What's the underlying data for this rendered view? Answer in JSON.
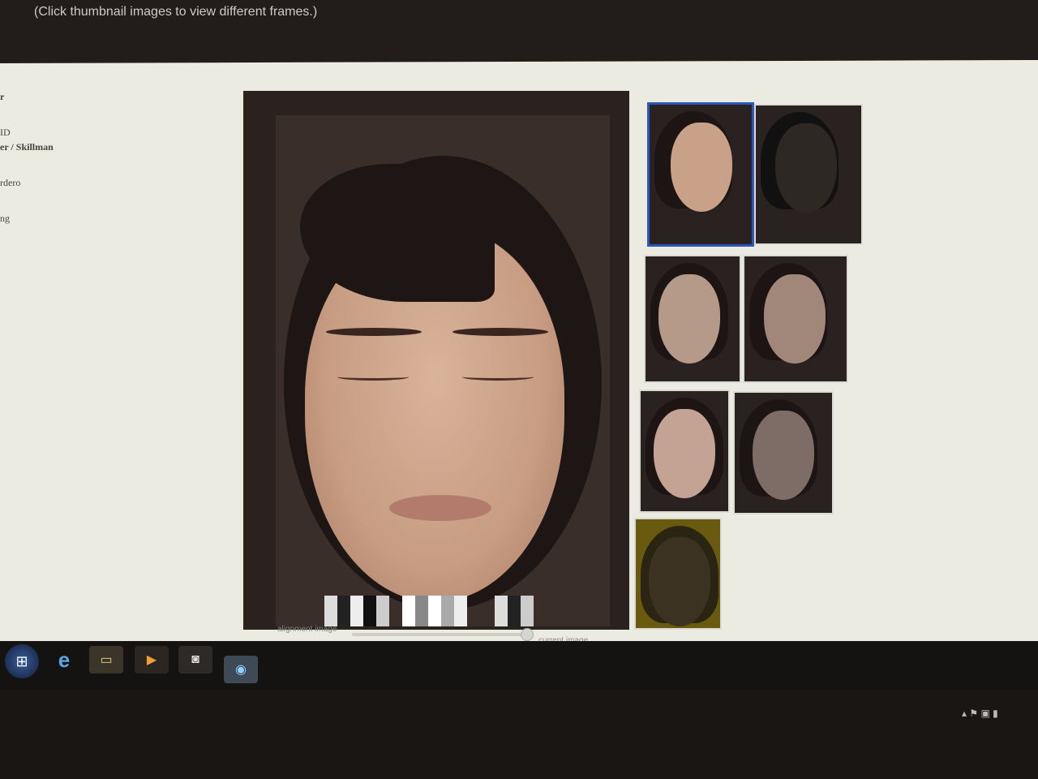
{
  "header": {
    "hint": "(Click thumbnail images to view different frames.)"
  },
  "sidebar": {
    "lines": [
      "r",
      "ID",
      "er / Skillman",
      "rdero",
      "ng"
    ]
  },
  "viewer": {
    "slider": {
      "left_label": "alignment image",
      "right_label": "current image",
      "value": 0.95
    }
  },
  "thumbnails": {
    "items": [
      {
        "label": "frame 1",
        "tone": "#c9a088",
        "selected": true
      },
      {
        "label": "frame 2",
        "tone": "#2e2825",
        "selected": false
      },
      {
        "label": "frame 3",
        "tone": "#b59a8a",
        "selected": false
      },
      {
        "label": "frame 4",
        "tone": "#a0877a",
        "selected": false
      },
      {
        "label": "frame 5",
        "tone": "#c4a394",
        "selected": false
      },
      {
        "label": "frame 6",
        "tone": "#7e6c66",
        "selected": false
      },
      {
        "label": "frame 7",
        "tone": "#3c3222",
        "selected": false
      }
    ]
  },
  "taskbar": {
    "buttons": [
      {
        "name": "start-button",
        "icon": "windows-orb-icon"
      },
      {
        "name": "internet-explorer-button",
        "icon": "ie-icon",
        "glyph": "e"
      },
      {
        "name": "file-explorer-button",
        "icon": "folder-icon",
        "glyph": "▭"
      },
      {
        "name": "media-player-button",
        "icon": "play-icon",
        "glyph": "▶"
      },
      {
        "name": "camera-app-button",
        "icon": "camera-icon",
        "glyph": "◙"
      },
      {
        "name": "active-app-button",
        "icon": "app-icon",
        "glyph": "◉"
      }
    ],
    "tray": "▴ ⚑ ▣ ▮"
  },
  "colors": {
    "selected_border": "#2c57b8",
    "screen_bg": "#ecebe2"
  }
}
